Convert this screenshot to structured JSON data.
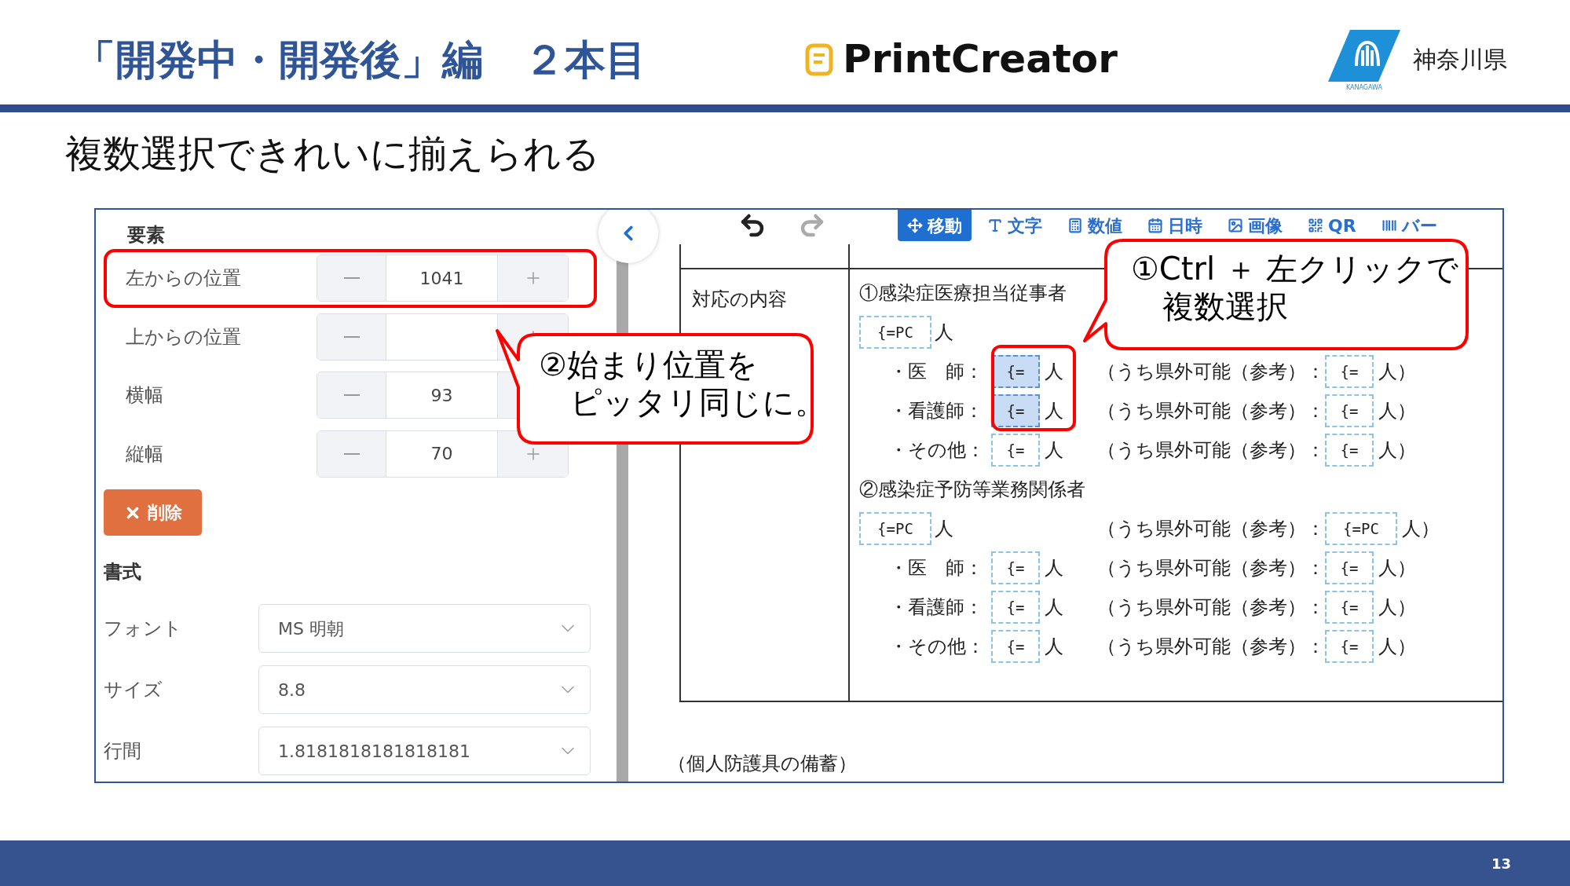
{
  "slide": {
    "title": "「開発中・開発後」編　２本目",
    "brand": "PrintCreator",
    "org": "神奈川県",
    "logo_caption": "KANAGAWA",
    "subtitle": "複数選択できれいに揃えられる",
    "page_number": "13"
  },
  "sidebar": {
    "section": "要素",
    "fields": [
      {
        "label": "左からの位置",
        "value": "1041",
        "highlighted": true
      },
      {
        "label": "上からの位置",
        "highlighted": false
      },
      {
        "label": "横幅",
        "value": "93",
        "highlighted": false
      },
      {
        "label": "縦幅",
        "value": "70",
        "highlighted": false
      }
    ],
    "delete_button": "削除",
    "format_section": "書式",
    "selects": [
      {
        "label": "フォント",
        "value": "MS 明朝"
      },
      {
        "label": "サイズ",
        "value": "8.8"
      },
      {
        "label": "行間",
        "value": "1.8181818181818181"
      }
    ]
  },
  "toolbar": {
    "tools": [
      {
        "kind": "move",
        "label": "移動",
        "selected": true
      },
      {
        "kind": "text",
        "label": "文字",
        "selected": false
      },
      {
        "kind": "number",
        "label": "数値",
        "selected": false
      },
      {
        "kind": "date",
        "label": "日時",
        "selected": false
      },
      {
        "kind": "image",
        "label": "画像",
        "selected": false
      },
      {
        "kind": "qr",
        "label": "QR",
        "selected": false
      },
      {
        "kind": "barcode",
        "label": "バー",
        "selected": false
      }
    ]
  },
  "document": {
    "row_header": "対応の内容",
    "selection_highlight": true,
    "sections": [
      {
        "heading": "①感染症医療担当従事者",
        "total": {
          "field": {
            "text": "{=PC",
            "selected": false
          },
          "unit": "人"
        },
        "items": [
          {
            "label": "・医　師：",
            "field": {
              "text": "{=",
              "selected": true
            },
            "unit": "人",
            "remote_label": "（うち県外可能（参考）：",
            "remote_field": {
              "text": "{=",
              "selected": false
            },
            "remote_unit": "人）"
          },
          {
            "label": "・看護師：",
            "field": {
              "text": "{=",
              "selected": true
            },
            "unit": "人",
            "remote_label": "（うち県外可能（参考）：",
            "remote_field": {
              "text": "{=",
              "selected": false
            },
            "remote_unit": "人）"
          },
          {
            "label": "・その他：",
            "field": {
              "text": "{=",
              "selected": false
            },
            "unit": "人",
            "remote_label": "（うち県外可能（参考）：",
            "remote_field": {
              "text": "{=",
              "selected": false
            },
            "remote_unit": "人）"
          }
        ]
      },
      {
        "heading": "②感染症予防等業務関係者",
        "total": {
          "field": {
            "text": "{=PC",
            "selected": false
          },
          "unit": "人",
          "remote_label": "（うち県外可能（参考）：",
          "remote_field": {
            "text": "{=PC",
            "selected": false
          },
          "remote_unit": "人）"
        },
        "items": [
          {
            "label": "・医　師：",
            "field": {
              "text": "{=",
              "selected": false
            },
            "unit": "人",
            "remote_label": "（うち県外可能（参考）：",
            "remote_field": {
              "text": "{=",
              "selected": false
            },
            "remote_unit": "人）"
          },
          {
            "label": "・看護師：",
            "field": {
              "text": "{=",
              "selected": false
            },
            "unit": "人",
            "remote_label": "（うち県外可能（参考）：",
            "remote_field": {
              "text": "{=",
              "selected": false
            },
            "remote_unit": "人）"
          },
          {
            "label": "・その他：",
            "field": {
              "text": "{=",
              "selected": false
            },
            "unit": "人",
            "remote_label": "（うち県外可能（参考）：",
            "remote_field": {
              "text": "{=",
              "selected": false
            },
            "remote_unit": "人）"
          }
        ]
      }
    ],
    "footer_text": "（個人防護具の備蓄）"
  },
  "callouts": [
    {
      "lines": [
        "①Ctrl ＋ 左クリックで",
        "複数選択"
      ]
    },
    {
      "lines": [
        "②始まり位置を",
        "ピッタリ同じに。"
      ]
    }
  ]
}
